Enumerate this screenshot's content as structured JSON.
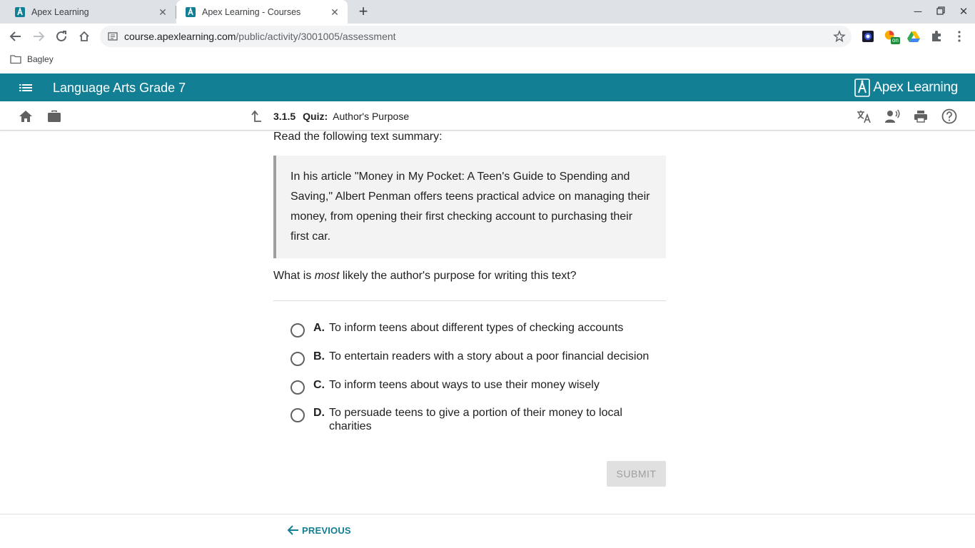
{
  "browser": {
    "tabs": [
      {
        "title": "Apex Learning",
        "active": false
      },
      {
        "title": "Apex Learning - Courses",
        "active": true
      }
    ],
    "url_host": "course.apexlearning.com",
    "url_path": "/public/activity/3001005/assessment",
    "bookmarks": [
      {
        "label": "Bagley"
      }
    ],
    "extension_badge": "on"
  },
  "app": {
    "course_title": "Language Arts Grade 7",
    "logo_text": "Apex Learning",
    "accent_color": "#127f94"
  },
  "breadcrumb": {
    "number": "3.1.5",
    "type": "Quiz:",
    "title": "Author's Purpose"
  },
  "quiz": {
    "instruction": "Read the following text summary:",
    "passage": "In his article \"Money in My Pocket: A Teen's Guide to Spending and Saving,\" Albert Penman offers teens practical advice on managing their money, from opening their first checking account to purchasing their first car.",
    "question_before": "What is ",
    "question_emphasis": "most",
    "question_after": " likely the author's purpose for writing this text?",
    "options": [
      {
        "letter": "A.",
        "text": "To inform teens about different types of checking accounts"
      },
      {
        "letter": "B.",
        "text": "To entertain readers with a story about a poor financial decision"
      },
      {
        "letter": "C.",
        "text": "To inform teens about ways to use their money wisely"
      },
      {
        "letter": "D.",
        "text": "To persuade teens to give a portion of their money to local charities"
      }
    ],
    "submit_label": "SUBMIT"
  },
  "footer": {
    "previous_label": "PREVIOUS"
  }
}
